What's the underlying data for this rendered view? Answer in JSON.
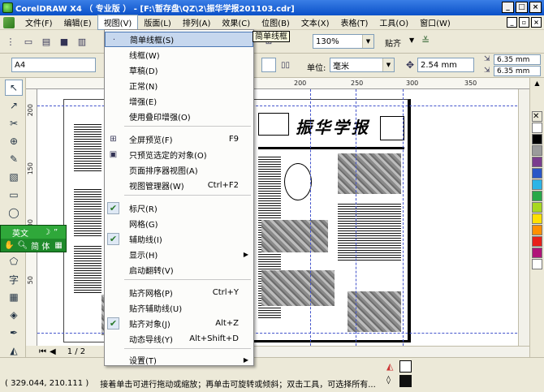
{
  "window": {
    "title": "CorelDRAW X4 （ 专业版 ） - [F:\\暂存盘\\QZ\\2\\振华学报201103.cdr]",
    "controls": {
      "minimize": "_",
      "maximize": "□",
      "close": "×"
    }
  },
  "menubar": {
    "items": [
      "文件(F)",
      "编辑(E)",
      "视图(V)",
      "版面(L)",
      "排列(A)",
      "效果(C)",
      "位图(B)",
      "文本(X)",
      "表格(T)",
      "工具(O)",
      "窗口(W)"
    ],
    "active": "视图(V)"
  },
  "toolbar": {
    "zoom_value": "130%",
    "snap_label": "贴齐",
    "icons": [
      "new-icon",
      "open-icon",
      "save-icon",
      "print-icon"
    ]
  },
  "propbar": {
    "paper_size": "A4",
    "unit_label": "单位:",
    "unit_value": "毫米",
    "nudge_value": "2.54 mm",
    "dup_x": "6.35 mm",
    "dup_y": "6.35 mm"
  },
  "ruler": {
    "h_labels": [
      "200",
      "250",
      "300",
      "350"
    ],
    "v_labels": [
      "200",
      "150",
      "100",
      "50"
    ]
  },
  "tooltip": "简单线框",
  "view_menu": {
    "items": [
      {
        "label": "简单线框(S)",
        "shortcut": "",
        "check": false,
        "icon": "",
        "sub": false,
        "highlight": true
      },
      {
        "label": "线框(W)",
        "shortcut": "",
        "check": false,
        "icon": "",
        "sub": false
      },
      {
        "label": "草稿(D)",
        "shortcut": "",
        "check": false,
        "icon": "",
        "sub": false
      },
      {
        "label": "正常(N)",
        "shortcut": "",
        "check": false,
        "icon": "",
        "sub": false
      },
      {
        "label": "增强(E)",
        "shortcut": "",
        "check": false,
        "icon": "",
        "sub": false
      },
      {
        "label": "使用叠印增强(O)",
        "shortcut": "",
        "check": false,
        "icon": "",
        "sub": false
      },
      {
        "label": "全屏预览(F)",
        "shortcut": "F9",
        "check": false,
        "icon": "fullscreen-icon",
        "sub": false
      },
      {
        "label": "只预览选定的对象(O)",
        "shortcut": "",
        "check": false,
        "icon": "preview-selected-icon",
        "sub": false
      },
      {
        "label": "页面排序器视图(A)",
        "shortcut": "",
        "check": false,
        "icon": "",
        "sub": false
      },
      {
        "label": "视图管理器(W)",
        "shortcut": "Ctrl+F2",
        "check": false,
        "icon": "",
        "sub": false
      },
      {
        "label": "标尺(R)",
        "shortcut": "",
        "check": true,
        "icon": "",
        "sub": false
      },
      {
        "label": "网格(G)",
        "shortcut": "",
        "check": false,
        "icon": "",
        "sub": false
      },
      {
        "label": "辅助线(I)",
        "shortcut": "",
        "check": true,
        "icon": "",
        "sub": false
      },
      {
        "label": "显示(H)",
        "shortcut": "",
        "check": false,
        "icon": "",
        "sub": true
      },
      {
        "label": "启动翻转(V)",
        "shortcut": "",
        "check": false,
        "icon": "",
        "sub": false
      },
      {
        "label": "贴齐网格(P)",
        "shortcut": "Ctrl+Y",
        "check": false,
        "icon": "",
        "sub": false
      },
      {
        "label": "贴齐辅助线(U)",
        "shortcut": "",
        "check": false,
        "icon": "",
        "sub": false
      },
      {
        "label": "贴齐对象(J)",
        "shortcut": "Alt+Z",
        "check": true,
        "icon": "",
        "sub": false
      },
      {
        "label": "动态导线(Y)",
        "shortcut": "Alt+Shift+D",
        "check": false,
        "icon": "",
        "sub": false
      },
      {
        "label": "设置(T)",
        "shortcut": "",
        "check": false,
        "icon": "",
        "sub": true
      }
    ]
  },
  "newspaper": {
    "masthead": "振华学报"
  },
  "ime": {
    "row1": "英文",
    "row2": "简 体"
  },
  "pagebar": {
    "page_label": "1 / 2"
  },
  "status": {
    "coords": "( 329.044, 210.111 )",
    "message": "接着单击可进行拖动或缩放；再单击可旋转或倾斜；双击工具，可选择所有..."
  },
  "palette": [
    "#ffffff",
    "#000000",
    "#9b9b9b",
    "#7a3d8e",
    "#2a56c6",
    "#2cb4e6",
    "#28a848",
    "#a8d820",
    "#ffe000",
    "#ff9000",
    "#e8201a",
    "#b01478",
    "#ffffff"
  ]
}
